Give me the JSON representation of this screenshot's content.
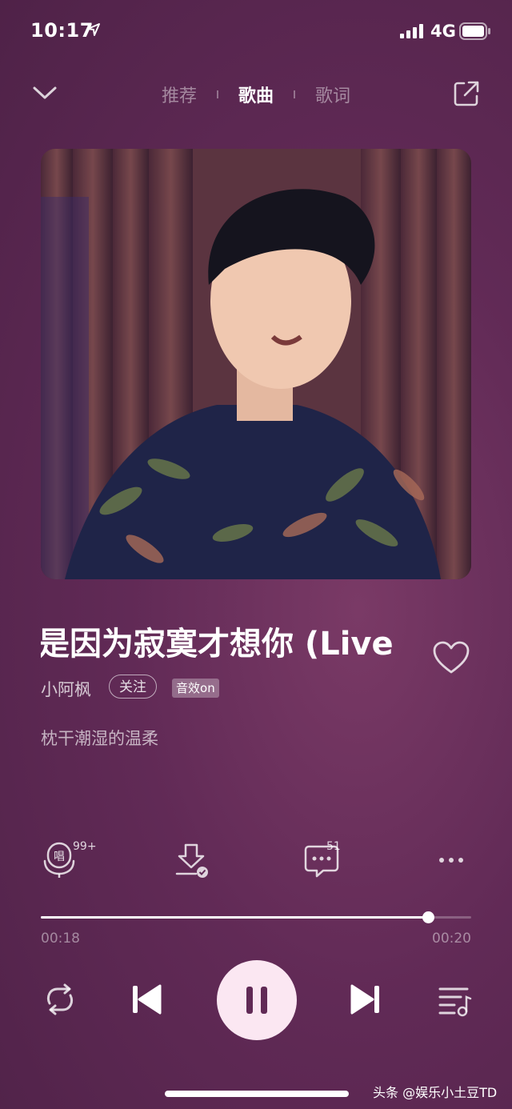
{
  "status": {
    "time": "10:17",
    "network": "4G"
  },
  "nav": {
    "tabs": [
      {
        "label": "推荐"
      },
      {
        "label": "歌曲"
      },
      {
        "label": "歌词"
      }
    ],
    "active": 1
  },
  "song": {
    "title": "是因为寂寞才想你 (Live",
    "artist": "小阿枫",
    "follow_label": "关注",
    "effect_label": "音效",
    "effect_state": "on",
    "lyric_line": "枕干潮湿的温柔"
  },
  "actions": {
    "sing_badge": "99+",
    "comment_count": "51",
    "sing_glyph": "唱"
  },
  "progress": {
    "elapsed": "00:18",
    "total": "00:20",
    "fraction": 0.9
  },
  "icons": [
    "chevron-down-icon",
    "share-icon",
    "heart-icon",
    "sing-mic-icon",
    "download-icon",
    "comment-icon",
    "more-icon",
    "repeat-icon",
    "previous-icon",
    "pause-icon",
    "next-icon",
    "playlist-icon"
  ],
  "colors": {
    "background": "#612a56",
    "play_button": "#fbe7f2"
  },
  "watermark": "头条 @娱乐小土豆TD"
}
